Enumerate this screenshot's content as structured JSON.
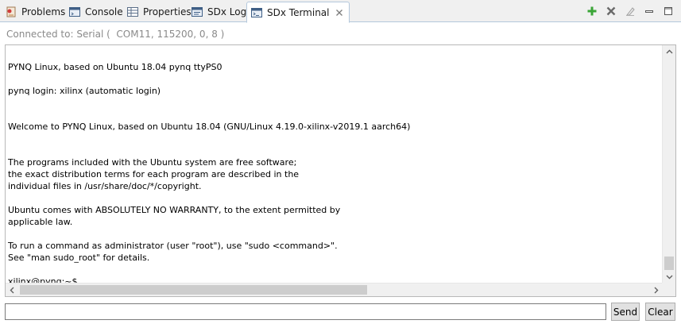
{
  "tabs": [
    {
      "label": "Problems",
      "icon": "problems-icon"
    },
    {
      "label": "Console",
      "icon": "console-icon"
    },
    {
      "label": "Properties",
      "icon": "properties-icon"
    },
    {
      "label": "SDx Log",
      "icon": "log-icon"
    },
    {
      "label": "SDx Terminal",
      "icon": "terminal-icon",
      "active": true
    }
  ],
  "toolbar": {
    "icons": [
      "add-terminal-icon",
      "remove-terminal-icon",
      "clear-icon",
      "minimize-icon",
      "maximize-icon"
    ]
  },
  "status": {
    "text": "Connected to: Serial (  COM11, 115200, 0, 8 )"
  },
  "terminal": {
    "lines": [
      "",
      "PYNQ Linux, based on Ubuntu 18.04 pynq ttyPS0",
      "",
      "pynq login: xilinx (automatic login)",
      "",
      "",
      "Welcome to PYNQ Linux, based on Ubuntu 18.04 (GNU/Linux 4.19.0-xilinx-v2019.1 aarch64)",
      "",
      "",
      "The programs included with the Ubuntu system are free software;",
      "the exact distribution terms for each program are described in the",
      "individual files in /usr/share/doc/*/copyright.",
      "",
      "Ubuntu comes with ABSOLUTELY NO WARRANTY, to the extent permitted by",
      "applicable law.",
      "",
      "To run a command as administrator (user \"root\"), use \"sudo <command>\".",
      "See \"man sudo_root\" for details.",
      "",
      "xilinx@pynq:~$"
    ]
  },
  "input": {
    "value": "",
    "placeholder": ""
  },
  "buttons": {
    "send": "Send",
    "clear": "Clear"
  }
}
